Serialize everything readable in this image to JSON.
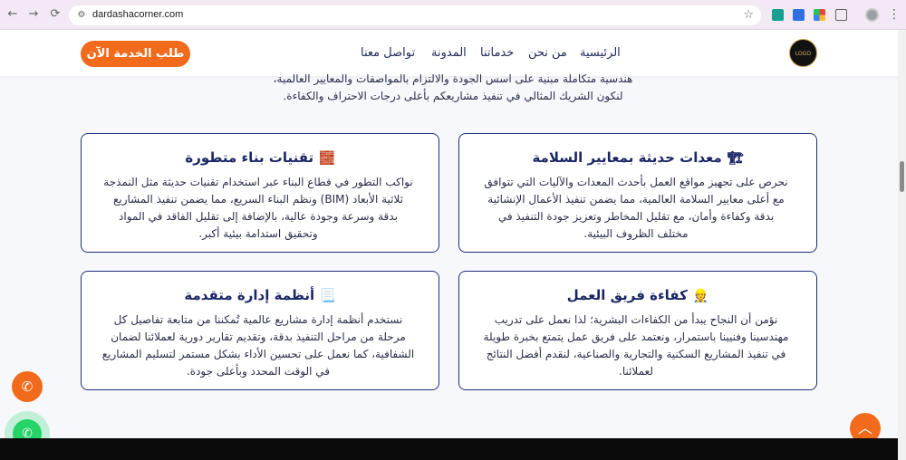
{
  "browser": {
    "url": "dardashacorner.com",
    "back_icon": "←",
    "forward_icon": "→",
    "reload_icon": "⟳",
    "site_info_icon": "⚙",
    "star_icon": "☆",
    "menu_icon": "⋮"
  },
  "header": {
    "cta_label": "طلب الخدمة الآن",
    "logo_text": "LOGO",
    "nav": [
      {
        "label": "الرئيسية"
      },
      {
        "label": "من نحن"
      },
      {
        "label": "خدماتنا"
      },
      {
        "label": "المدونة"
      },
      {
        "label": "تواصل معنا"
      }
    ]
  },
  "intro": {
    "line1": "هندسية متكاملة مبنية على اسس الجودة والالتزام بالمواصفات والمعايير العالمية،",
    "line2": "لنكون الشريك المثالي في تنفيذ مشاريعكم بأعلى درجات الاحتراف والكفاءة."
  },
  "cards": [
    {
      "icon": "🏗",
      "title": "معدات حديثة بمعايير السلامة",
      "lines": [
        "نحرص على تجهيز مواقع العمل بأحدث المعدات والآليات التي تتوافق",
        "مع أعلى معايير السلامة العالمية، مما يضمن تنفيذ الأعمال الإنشائية",
        "بدقة وكفاءة وأمان، مع تقليل المخاطر وتعزيز جودة التنفيذ في",
        "مختلف الظروف البيئية."
      ]
    },
    {
      "icon": "🧱",
      "title": "تقنيات بناء متطورة",
      "lines": [
        "نواكب التطور في قطاع البناء عبر استخدام تقنيات حديثة مثل النمذجة",
        "ثلاثية الأبعاد (BIM) ونظم البناء السريع، مما يضمن تنفيذ المشاريع",
        "بدقة وسرعة وجودة عالية، بالإضافة إلى تقليل الفاقد في المواد",
        "وتحقيق استدامة بيئية أكبر."
      ]
    },
    {
      "icon": "👷",
      "title": "كفاءة فريق العمل",
      "lines": [
        "نؤمن أن النجاح يبدأ من الكفاءات البشرية؛ لذا نعمل على تدريب",
        "مهندسينا وفنيينا باستمرار، ونعتمد على فريق عمل يتمتع بخبرة طويلة",
        "في تنفيذ المشاريع السكنية والتجارية والصناعية، لنقدم أفضل النتائج",
        "لعملائنا."
      ]
    },
    {
      "icon": "📃",
      "title": "أنظمة إدارة متقدمة",
      "lines": [
        "نستخدم أنظمة إدارة مشاريع عالمية تُمكننا من متابعة تفاصيل كل",
        "مرحلة من مراحل التنفيذ بدقة، وتقديم تقارير دورية لعملائنا لضمان",
        "الشفافية، كما نعمل على تحسين الأداء بشكل مستمر لتسليم المشاريع",
        "في الوقت المحدد وبأعلى جودة."
      ]
    }
  ],
  "floating": {
    "phone_icon": "✆",
    "whatsapp_icon": "✆",
    "scroll_up_icon": "︿"
  }
}
